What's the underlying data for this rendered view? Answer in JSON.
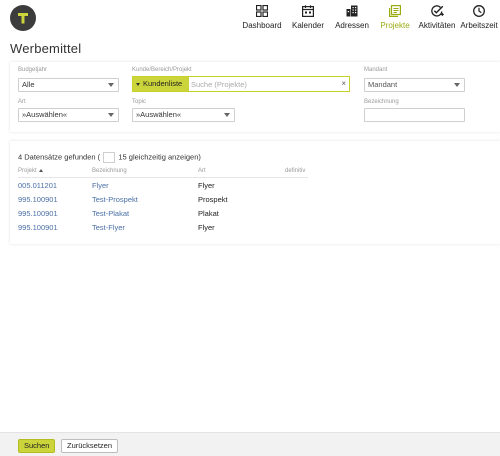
{
  "nav": [
    {
      "label": "Dashboard",
      "icon": "dashboard-icon",
      "active": false
    },
    {
      "label": "Kalender",
      "icon": "calendar-icon",
      "active": false
    },
    {
      "label": "Adressen",
      "icon": "buildings-icon",
      "active": false
    },
    {
      "label": "Projekte",
      "icon": "projects-icon",
      "active": true
    },
    {
      "label": "Aktivitäten",
      "icon": "activity-check-icon",
      "active": false
    },
    {
      "label": "Arbeitszeit",
      "icon": "clock-icon",
      "active": false
    }
  ],
  "page": {
    "title": "Werbemittel"
  },
  "filters": {
    "budgetjahr": {
      "label": "Budgetjahr",
      "value": "Alle"
    },
    "kunde": {
      "label": "Kunde/Bereich/Projekt",
      "button": "Kundenliste",
      "placeholder": "Suche (Projekte)",
      "clear": "×"
    },
    "mandant": {
      "label": "Mandant",
      "value": "Mandant"
    },
    "art": {
      "label": "Art",
      "value": "»Auswählen«"
    },
    "topic": {
      "label": "Topic",
      "value": "»Auswählen«"
    },
    "bezeichnung": {
      "label": "Bezeichnung",
      "value": ""
    }
  },
  "results": {
    "count_prefix": "4 Datensätze gefunden (",
    "count_suffix": "15 gleichzeitig anzeigen)",
    "columns": [
      "Projekt",
      "Bezeichnung",
      "Art",
      "definitiv"
    ],
    "rows": [
      {
        "projekt": "005.011201",
        "bezeichnung": "Flyer",
        "art": "Flyer"
      },
      {
        "projekt": "995.100901",
        "bezeichnung": "Test-Prospekt",
        "art": "Prospekt"
      },
      {
        "projekt": "995.100901",
        "bezeichnung": "Test-Plakat",
        "art": "Plakat"
      },
      {
        "projekt": "995.100901",
        "bezeichnung": "Test-Flyer",
        "art": "Flyer"
      }
    ]
  },
  "footer": {
    "search": "Suchen",
    "reset": "Zurücksetzen"
  },
  "colors": {
    "accent": "#cbd43a",
    "active_nav": "#9aab12",
    "link": "#4a6fa5",
    "logo_bg": "#3c3c3c"
  }
}
